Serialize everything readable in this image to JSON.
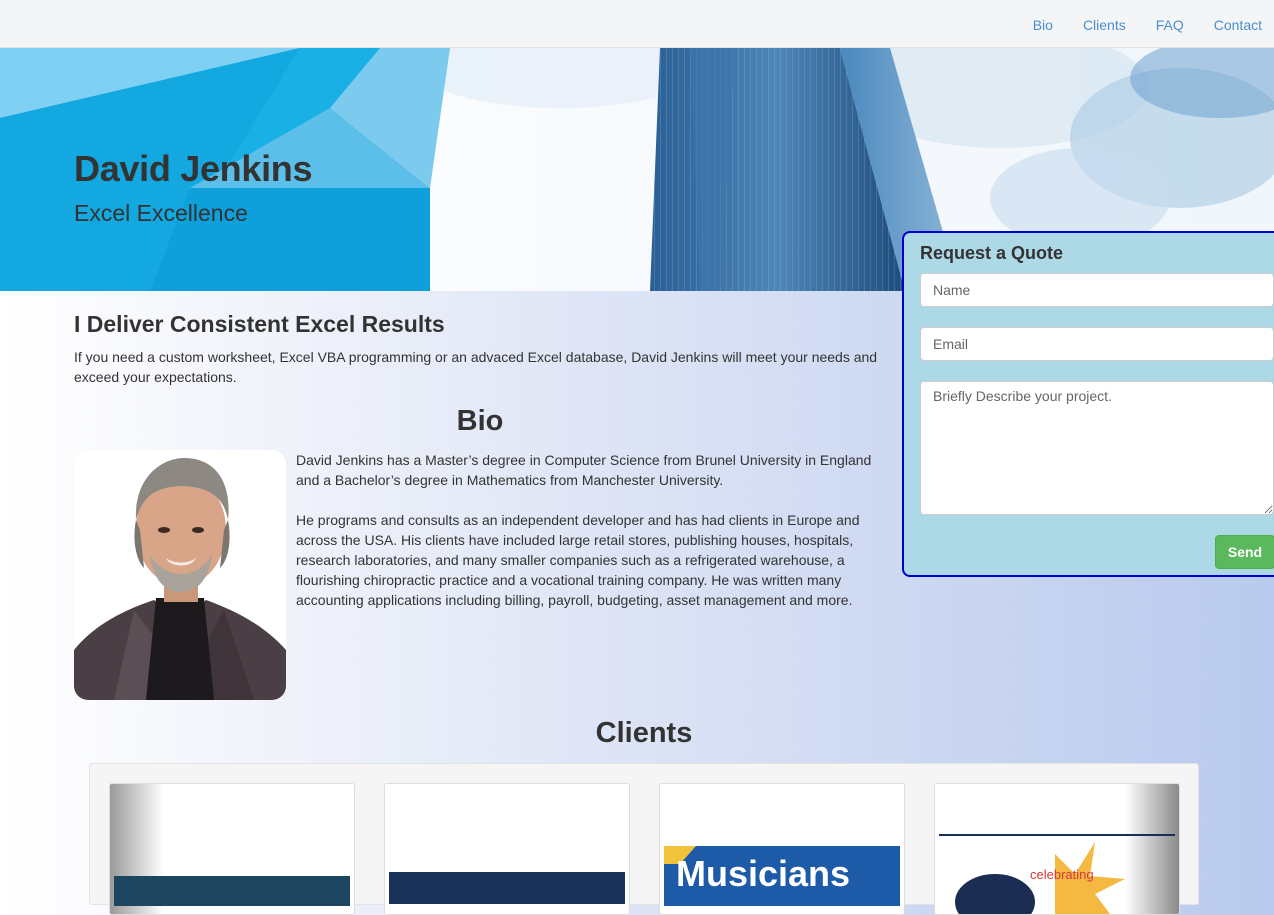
{
  "nav": {
    "items": [
      {
        "label": "Bio"
      },
      {
        "label": "Clients"
      },
      {
        "label": "FAQ"
      },
      {
        "label": "Contact"
      }
    ]
  },
  "hero": {
    "title": "David Jenkins",
    "subtitle": "Excel Excellence"
  },
  "intro": {
    "heading": "I Deliver Consistent Excel Results",
    "text": "If you need a custom worksheet, Excel VBA programming or an advaced Excel database, David Jenkins will meet your needs and exceed your expectations."
  },
  "bio": {
    "heading": "Bio",
    "paragraphs": [
      "David Jenkins has a Master’s degree in Computer Science from Brunel University in England and a Bachelor’s degree in Mathematics from Manchester University.",
      "He programs and consults as an independent developer and has had clients in Europe and across the USA. His clients have included large retail stores, publishing houses, hospitals, research laboratories, and many smaller companies such as a refrigerated warehouse, a flourishing chiropractic practice and a vocational training company. He was written many accounting applications including billing, payroll, budgeting, asset management and more."
    ]
  },
  "clients": {
    "heading": "Clients",
    "logos": [
      {
        "text": ""
      },
      {
        "text": ""
      },
      {
        "text": "Musicians"
      },
      {
        "text": "celebrating"
      }
    ]
  },
  "quote": {
    "title": "Request a Quote",
    "name_placeholder": "Name",
    "email_placeholder": "Email",
    "description_placeholder": "Briefly Describe your project.",
    "send_label": "Send"
  },
  "colors": {
    "link": "#4a8fcc",
    "send_button": "#5cb85c",
    "quote_background": "#add8e6",
    "quote_border": "#0000cd",
    "hero_blue": "#17aee4"
  }
}
